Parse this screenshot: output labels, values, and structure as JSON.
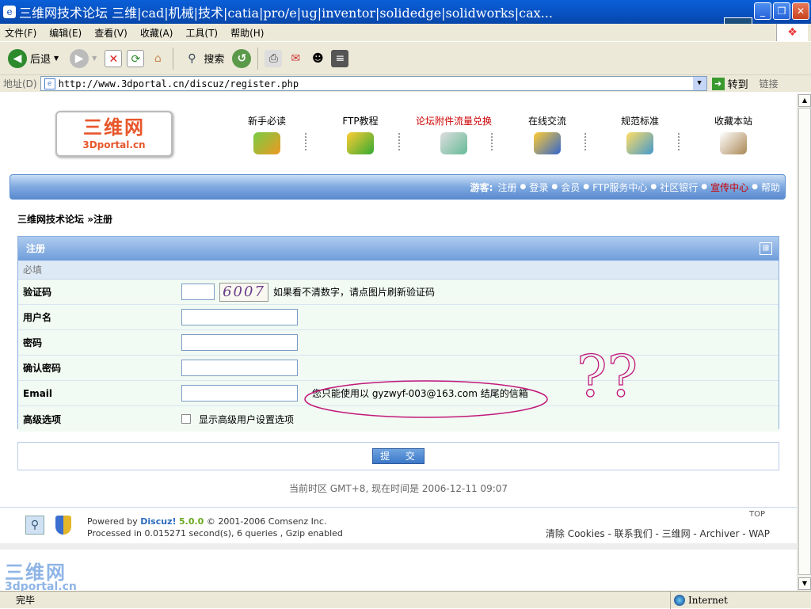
{
  "window": {
    "title": "三维网技术论坛 三维|cad|机械|技术|catia|pro/e|ug|inventor|solidedge|solidworks|cax..."
  },
  "menubar": [
    "文件(F)",
    "编辑(E)",
    "查看(V)",
    "收藏(A)",
    "工具(T)",
    "帮助(H)"
  ],
  "toolbar": {
    "back": "后退",
    "search": "搜索"
  },
  "address": {
    "label": "地址(D)",
    "url": "http://www.3dportal.cn/discuz/register.php",
    "go": "转到",
    "links": "链接"
  },
  "site": {
    "logo_cn": "三维网",
    "logo_en": "3Dportal.cn",
    "nav": [
      "新手必读",
      "FTP教程",
      "论坛附件流量兑换",
      "在线交流",
      "规范标准",
      "收藏本站"
    ]
  },
  "userbar": {
    "guest_label": "游客:",
    "links": [
      "注册",
      "登录",
      "会员",
      "FTP服务中心",
      "社区银行",
      "宣传中心",
      "帮助"
    ]
  },
  "breadcrumb": {
    "home": "三维网技术论坛",
    "sep": " »",
    "current": "注册"
  },
  "form": {
    "title": "注册",
    "required_label": "必填",
    "captcha_label": "验证码",
    "captcha_text": "6007",
    "captcha_hint": "如果看不清数字，请点图片刷新验证码",
    "username_label": "用户名",
    "password_label": "密码",
    "confirm_label": "确认密码",
    "email_label": "Email",
    "email_hint": "您只能使用以 gyzwyf-003@163.com 结尾的信箱",
    "advanced_label": "高级选项",
    "advanced_checkbox": "显示高级用户设置选项",
    "submit": "提 交"
  },
  "timezone_text": "当前时区 GMT+8, 现在时间是 2006-12-11 09:07",
  "footer": {
    "powered_pre": "Powered by ",
    "powered_name": "Discuz!",
    "powered_ver": "5.0.0",
    "copyright": "© 2001-2006 Comsenz Inc.",
    "processed": "Processed in 0.015271 second(s), 6 queries , Gzip enabled",
    "top": "TOP",
    "links": "清除 Cookies - 联系我们 - 三维网 - Archiver - WAP"
  },
  "watermark": {
    "cn": "三维网",
    "en": "3dportal.cn"
  },
  "annotation": {
    "text": "??"
  },
  "status": {
    "left": "完毕",
    "zone": "Internet"
  },
  "colors": {
    "title_bar": "#0850c0",
    "nav_bar": "#6f9ede",
    "highlight_red": "#cc0000",
    "annotation": "#c2187a"
  }
}
